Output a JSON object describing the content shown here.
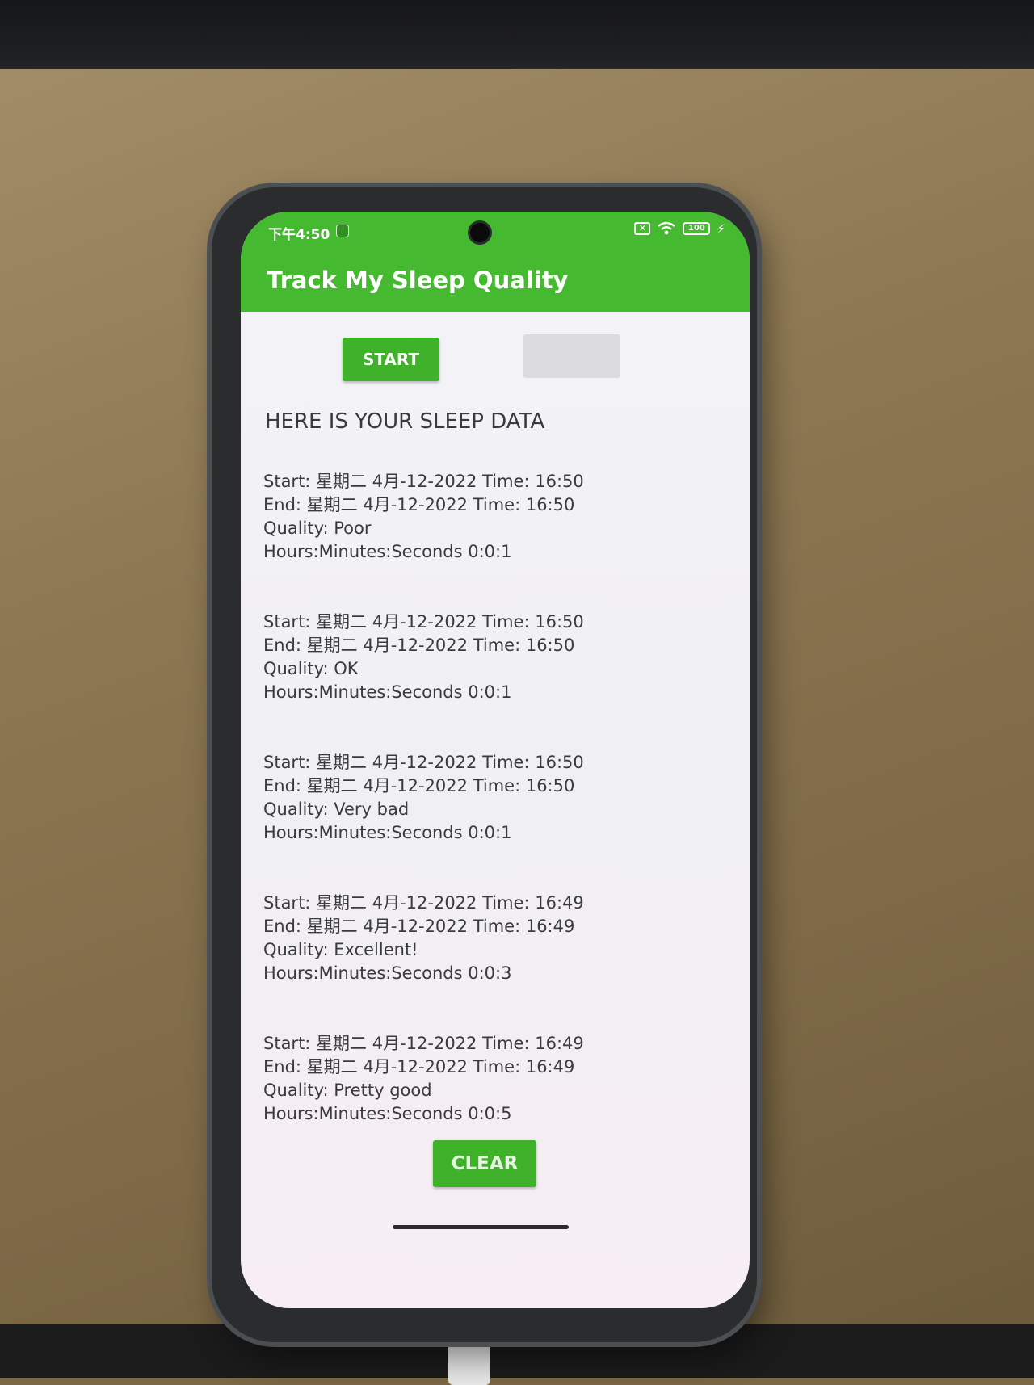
{
  "status_bar": {
    "time": "下午4:50",
    "sim_icon": "sim-off-icon",
    "wifi_icon": "wifi-icon",
    "battery_level": "100",
    "charging_icon": "bolt-icon"
  },
  "app_bar": {
    "title": "Track My Sleep Quality",
    "color": "#45b92f"
  },
  "controls": {
    "start_label": "START",
    "stop_label": ""
  },
  "section_heading": "HERE IS YOUR SLEEP DATA",
  "records": [
    {
      "start": "Start: 星期二 4月-12-2022 Time: 16:50",
      "end": "End: 星期二 4月-12-2022 Time: 16:50",
      "quality": "Quality: Poor",
      "duration": "Hours:Minutes:Seconds 0:0:1"
    },
    {
      "start": "Start: 星期二 4月-12-2022 Time: 16:50",
      "end": "End: 星期二 4月-12-2022 Time: 16:50",
      "quality": "Quality: OK",
      "duration": "Hours:Minutes:Seconds 0:0:1"
    },
    {
      "start": "Start: 星期二 4月-12-2022 Time: 16:50",
      "end": "End: 星期二 4月-12-2022 Time: 16:50",
      "quality": "Quality: Very bad",
      "duration": "Hours:Minutes:Seconds 0:0:1"
    },
    {
      "start": "Start: 星期二 4月-12-2022 Time: 16:49",
      "end": "End: 星期二 4月-12-2022 Time: 16:49",
      "quality": "Quality: Excellent!",
      "duration": "Hours:Minutes:Seconds 0:0:3"
    },
    {
      "start": "Start: 星期二 4月-12-2022 Time: 16:49",
      "end": "End: 星期二 4月-12-2022 Time: 16:49",
      "quality": "Quality: Pretty good",
      "duration": "Hours:Minutes:Seconds 0:0:5"
    }
  ],
  "clear_label": "CLEAR",
  "colors": {
    "accent": "#45b92f",
    "button": "#3fb12b",
    "text": "#3b3b3e",
    "background": "#f4f3f7"
  }
}
